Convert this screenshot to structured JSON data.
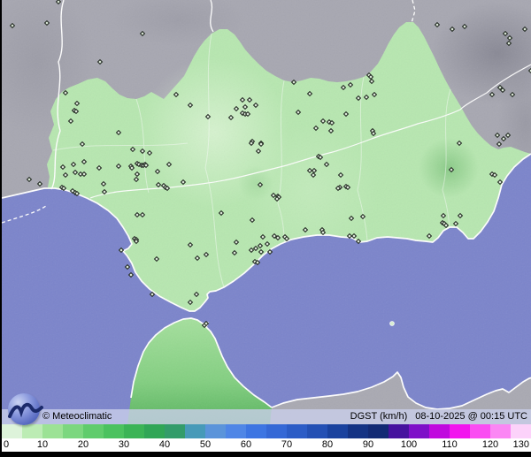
{
  "caption": {
    "copyright": "© Meteoclimatic",
    "product": "DGST (km/h)",
    "datetime": "08-10-2025 @ 00:15 UTC"
  },
  "scale": {
    "unit": "km/h",
    "min": 0,
    "max": 130,
    "ticks": [
      "0",
      "10",
      "20",
      "30",
      "40",
      "50",
      "60",
      "70",
      "80",
      "90",
      "100",
      "110",
      "120",
      "130"
    ],
    "segments": [
      "#ddf3da",
      "#bcecb4",
      "#9ce295",
      "#7cd77f",
      "#60cc6c",
      "#4bc25f",
      "#3bb456",
      "#30a656",
      "#339c6a",
      "#479ab8",
      "#5b94da",
      "#4f86e6",
      "#3d75e2",
      "#3568d6",
      "#2c5cc6",
      "#2450b4",
      "#1a429e",
      "#143384",
      "#122a74",
      "#46129e",
      "#7e10c8",
      "#c009de",
      "#f215ee",
      "#fa4cf2",
      "#fb86f4",
      "#fcd2fa"
    ]
  },
  "map_colors": {
    "sea": "#7b84cb",
    "land_outside": "#a7a7b1",
    "region_fill": "#b7e7b0",
    "gust_blob": "#6db86d",
    "coastline": "#ffffff"
  },
  "stations": [
    [
      12,
      29
    ],
    [
      51,
      26
    ],
    [
      64,
      2
    ],
    [
      111,
      70
    ],
    [
      159,
      38
    ],
    [
      72,
      105
    ],
    [
      85,
      117
    ],
    [
      82,
      125
    ],
    [
      84,
      126
    ],
    [
      78,
      137
    ],
    [
      91,
      163
    ],
    [
      31,
      203
    ],
    [
      43,
      208
    ],
    [
      68,
      212
    ],
    [
      70,
      213
    ],
    [
      80,
      216
    ],
    [
      83,
      218
    ],
    [
      85,
      219
    ],
    [
      69,
      189
    ],
    [
      81,
      186
    ],
    [
      93,
      183
    ],
    [
      72,
      198
    ],
    [
      83,
      195
    ],
    [
      89,
      197
    ],
    [
      93,
      197
    ],
    [
      110,
      190
    ],
    [
      115,
      208
    ],
    [
      116,
      217
    ],
    [
      132,
      150
    ],
    [
      148,
      169
    ],
    [
      159,
      171
    ],
    [
      167,
      173
    ],
    [
      132,
      188
    ],
    [
      146,
      188
    ],
    [
      147,
      190
    ],
    [
      153,
      185
    ],
    [
      155,
      186
    ],
    [
      158,
      187
    ],
    [
      160,
      187
    ],
    [
      162,
      186
    ],
    [
      163,
      187
    ],
    [
      153,
      197
    ],
    [
      176,
      194
    ],
    [
      189,
      186
    ],
    [
      152,
      203
    ],
    [
      177,
      209
    ],
    [
      183,
      210
    ],
    [
      185,
      212
    ],
    [
      187,
      213
    ],
    [
      205,
      206
    ],
    [
      153,
      243
    ],
    [
      159,
      243
    ],
    [
      150,
      270
    ],
    [
      152,
      271
    ],
    [
      135,
      283
    ],
    [
      142,
      302
    ],
    [
      146,
      311
    ],
    [
      170,
      333
    ],
    [
      175,
      293
    ],
    [
      152,
      273
    ],
    [
      197,
      107
    ],
    [
      213,
      119
    ],
    [
      233,
      132
    ],
    [
      259,
      133
    ],
    [
      265,
      123
    ],
    [
      272,
      113
    ],
    [
      280,
      113
    ],
    [
      287,
      119
    ],
    [
      275,
      121
    ],
    [
      272,
      128
    ],
    [
      275,
      129
    ],
    [
      278,
      129
    ],
    [
      283,
      160
    ],
    [
      293,
      162
    ],
    [
      330,
      93
    ],
    [
      348,
      106
    ],
    [
      335,
      127
    ],
    [
      355,
      145
    ],
    [
      415,
      85
    ],
    [
      417,
      87
    ],
    [
      418,
      92
    ],
    [
      386,
      99
    ],
    [
      394,
      96
    ],
    [
      403,
      111
    ],
    [
      412,
      110
    ],
    [
      421,
      107
    ],
    [
      389,
      129
    ],
    [
      363,
      137
    ],
    [
      370,
      138
    ],
    [
      373,
      139
    ],
    [
      372,
      148
    ],
    [
      419,
      148
    ],
    [
      420,
      151
    ],
    [
      358,
      177
    ],
    [
      360,
      178
    ],
    [
      367,
      186
    ],
    [
      348,
      193
    ],
    [
      353,
      193
    ],
    [
      352,
      198
    ],
    [
      383,
      198
    ],
    [
      382,
      212
    ],
    [
      380,
      213
    ],
    [
      389,
      211
    ],
    [
      391,
      212
    ],
    [
      282,
      162
    ],
    [
      293,
      163
    ],
    [
      290,
      171
    ],
    [
      292,
      209
    ],
    [
      307,
      221
    ],
    [
      312,
      222
    ],
    [
      313,
      223
    ],
    [
      311,
      225
    ],
    [
      283,
      249
    ],
    [
      248,
      241
    ],
    [
      343,
      260
    ],
    [
      362,
      260
    ],
    [
      363,
      263
    ],
    [
      295,
      268
    ],
    [
      308,
      267
    ],
    [
      312,
      269
    ],
    [
      320,
      268
    ],
    [
      322,
      270
    ],
    [
      300,
      276
    ],
    [
      292,
      278
    ],
    [
      282,
      283
    ],
    [
      303,
      285
    ],
    [
      393,
      267
    ],
    [
      398,
      267
    ],
    [
      403,
      273
    ],
    [
      395,
      247
    ],
    [
      408,
      245
    ],
    [
      499,
      244
    ],
    [
      518,
      244
    ],
    [
      498,
      252
    ],
    [
      500,
      253
    ],
    [
      502,
      255
    ],
    [
      513,
      253
    ],
    [
      483,
      267
    ],
    [
      508,
      192
    ],
    [
      517,
      162
    ],
    [
      554,
      197
    ],
    [
      557,
      198
    ],
    [
      563,
      206
    ],
    [
      569,
      38
    ],
    [
      574,
      43
    ],
    [
      573,
      49
    ],
    [
      591,
      33
    ],
    [
      598,
      80
    ],
    [
      563,
      99
    ],
    [
      566,
      102
    ],
    [
      554,
      107
    ],
    [
      577,
      107
    ],
    [
      560,
      153
    ],
    [
      567,
      157
    ],
    [
      562,
      163
    ],
    [
      572,
      153
    ],
    [
      492,
      28
    ],
    [
      509,
      33
    ],
    [
      523,
      30
    ],
    [
      213,
      277
    ],
    [
      221,
      292
    ],
    [
      231,
      288
    ],
    [
      213,
      342
    ],
    [
      220,
      333
    ],
    [
      265,
      274
    ],
    [
      263,
      286
    ],
    [
      287,
      281
    ],
    [
      293,
      285
    ],
    [
      286,
      296
    ],
    [
      289,
      297
    ],
    [
      229,
      368
    ],
    [
      231,
      366
    ]
  ]
}
